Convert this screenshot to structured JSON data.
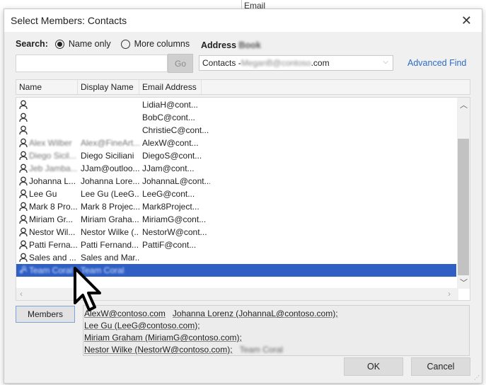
{
  "background": {
    "column_label": "Email"
  },
  "dialog": {
    "title": "Select Members: Contacts",
    "close_icon": "close-icon",
    "search": {
      "label": "Search:",
      "options": [
        {
          "label": "Name only",
          "selected": true
        },
        {
          "label": "More columns",
          "selected": false
        }
      ],
      "input_value": "",
      "go_label": "Go"
    },
    "address_book": {
      "label": "Address Book",
      "label_blurred_suffix": "Book",
      "label_prefix": "Address",
      "selected_prefix": "Contacts - ",
      "selected_blurred": "MeganB@contoso",
      "selected_suffix": ".com",
      "advanced_find_label": "Advanced Find"
    },
    "columns": [
      "Name",
      "Display Name",
      "Email Address"
    ],
    "rows": [
      {
        "name": "",
        "display": "",
        "email": "LidiaH@cont...",
        "blur_name": false
      },
      {
        "name": "",
        "display": "",
        "email": "BobC@cont...",
        "blur_name": false
      },
      {
        "name": "",
        "display": "",
        "email": "ChristieC@cont...",
        "blur_name": false
      },
      {
        "name": "Alex Wilber",
        "display": "Alex@FineArt...",
        "email": "AlexW@cont...",
        "blur_name": true
      },
      {
        "name": "Diego Sicil...",
        "display": "Diego Siciliani",
        "email": "DiegoS@cont...",
        "blur_name": true
      },
      {
        "name": "Jeb Jamba...",
        "display": "JJam@outloo...",
        "email": "JJam@cont...",
        "blur_name": true
      },
      {
        "name": "Johanna L...",
        "display": "Johanna Lore...",
        "email": "JohannaL@cont...",
        "blur_name": false
      },
      {
        "name": "Lee Gu",
        "display": "Lee Gu (LeeG...",
        "email": "LeeG@cont...",
        "blur_name": false
      },
      {
        "name": "Mark 8 Pro...",
        "display": "Mark 8 Projec...",
        "email": "Mark8Project...",
        "blur_name": false
      },
      {
        "name": "Miriam Gr...",
        "display": "Miriam Graha...",
        "email": "MiriamG@cont...",
        "blur_name": false
      },
      {
        "name": "Nestor Wil...",
        "display": "Nestor Wilke (...",
        "email": "NestorW@cont...",
        "blur_name": false
      },
      {
        "name": "Patti Ferna...",
        "display": "Patti Fernand...",
        "email": "PattiF@cont...",
        "blur_name": false
      },
      {
        "name": "Sales and ...",
        "display": "Sales and Mar...",
        "email": "",
        "blur_name": false
      },
      {
        "name": "Team Coral",
        "display": "Team Coral",
        "email": "",
        "selected": true,
        "group": true
      }
    ],
    "members_button_label": "Members",
    "members": [
      "AlexW@contoso.com",
      "Johanna Lorenz (JohannaL@contoso.com);",
      "Lee Gu (LeeG@contoso.com);",
      "Miriam Graham (MiriamG@contoso.com);",
      "Nestor Wilke (NestorW@contoso.com);",
      "Team Coral"
    ],
    "ok_label": "OK",
    "cancel_label": "Cancel"
  },
  "colors": {
    "selection": "#2f5fc4",
    "link": "#2e6bc6",
    "scroll_thumb": "#c2c2c2"
  }
}
